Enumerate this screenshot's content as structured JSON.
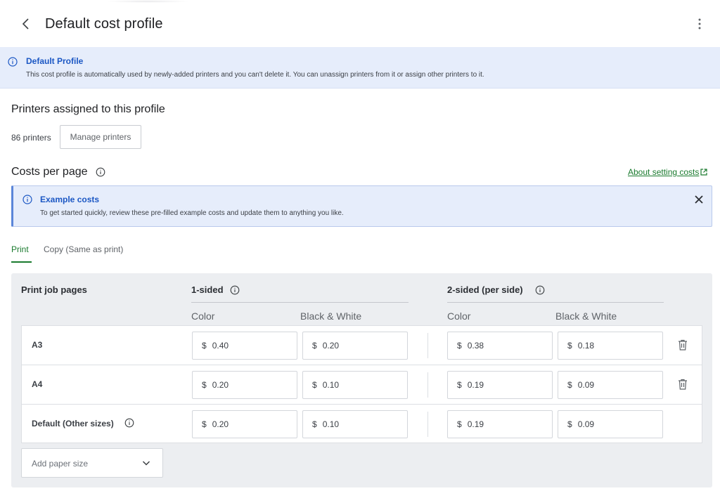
{
  "header": {
    "title": "Default cost profile",
    "back_icon": "chevron-left-icon",
    "menu_icon": "more-vert-icon"
  },
  "profile_banner": {
    "title": "Default Profile",
    "text": "This cost profile is automatically used by newly-added printers and you can't delete it. You can unassign printers from it or assign other printers to it."
  },
  "printers_section": {
    "title": "Printers assigned to this profile",
    "count": "86 printers",
    "manage_label": "Manage printers"
  },
  "costs_section": {
    "title": "Costs per page",
    "about_link": "About setting costs"
  },
  "example_banner": {
    "title": "Example costs",
    "text": "To get started quickly, review these pre-filled example costs and update them to anything you like."
  },
  "tabs": [
    {
      "label": "Print",
      "active": true
    },
    {
      "label": "Copy (Same as print)",
      "active": false
    }
  ],
  "table": {
    "row_header": "Print job pages",
    "one_sided": "1-sided",
    "two_sided": "2-sided (per side)",
    "color": "Color",
    "bw": "Black & White",
    "currency": "$",
    "rows": [
      {
        "label": "A3",
        "c1": "0.40",
        "b1": "0.20",
        "c2": "0.38",
        "b2": "0.18",
        "deletable": true
      },
      {
        "label": "A4",
        "c1": "0.20",
        "b1": "0.10",
        "c2": "0.19",
        "b2": "0.09",
        "deletable": true
      },
      {
        "label": "Default (Other sizes)",
        "c1": "0.20",
        "b1": "0.10",
        "c2": "0.19",
        "b2": "0.09",
        "deletable": false
      }
    ],
    "add_paper_label": "Add paper size"
  },
  "colors": {
    "accent_green": "#1a7a2e",
    "info_blue": "#1b57c4",
    "banner_bg": "#e6edfb"
  }
}
